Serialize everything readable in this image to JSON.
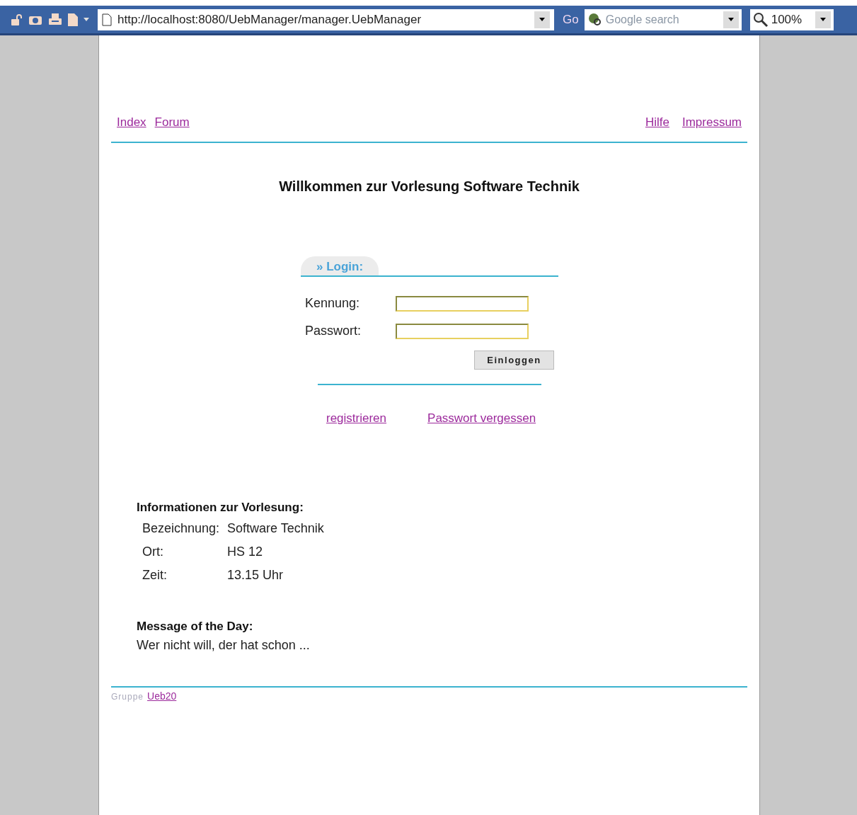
{
  "toolbar": {
    "url": "http://localhost:8080/UebManager/manager.UebManager",
    "go": "Go",
    "search": {
      "placeholder": "Google search"
    },
    "zoom": "100%"
  },
  "nav": {
    "left": [
      "Index",
      "Forum"
    ],
    "right": [
      "Hilfe",
      "Impressum"
    ]
  },
  "heading": "Willkommen zur Vorlesung Software Technik",
  "login": {
    "tab": "» Login:",
    "fields": [
      {
        "label": "Kennung:"
      },
      {
        "label": "Passwort:"
      }
    ],
    "button": "Einloggen",
    "links": [
      "registrieren",
      "Passwort vergessen"
    ]
  },
  "info": {
    "title": "Informationen zur Vorlesung:",
    "rows": [
      {
        "label": "Bezeichnung:",
        "value": "Software Technik"
      },
      {
        "label": "Ort:",
        "value": "HS 12"
      },
      {
        "label": "Zeit:",
        "value": "13.15 Uhr"
      }
    ]
  },
  "motd": {
    "title": "Message of the Day:",
    "text": "Wer nicht will, der hat schon ..."
  },
  "footer": {
    "text": "Gruppe",
    "link": "Ueb20"
  }
}
